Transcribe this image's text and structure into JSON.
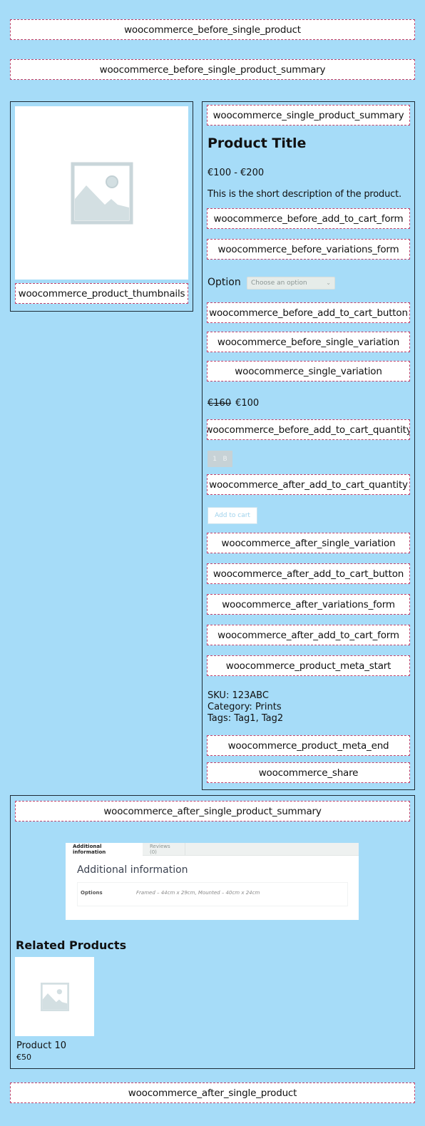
{
  "colors": {
    "background": "#a6dcf8",
    "hook_border": "#c0426a",
    "panel_border": "#1d2b36"
  },
  "hooks": {
    "before_single_product": "woocommerce_before_single_product",
    "before_single_product_summary": "woocommerce_before_single_product_summary",
    "product_thumbnails": "woocommerce_product_thumbnails",
    "single_product_summary": "woocommerce_single_product_summary",
    "before_add_to_cart_form": "woocommerce_before_add_to_cart_form",
    "before_variations_form": "woocommerce_before_variations_form",
    "before_add_to_cart_button": "woocommerce_before_add_to_cart_button",
    "before_single_variation": "woocommerce_before_single_variation",
    "single_variation": "woocommerce_single_variation",
    "before_add_to_cart_quantity": "woocommerce_before_add_to_cart_quantity",
    "after_add_to_cart_quantity": "woocommerce_after_add_to_cart_quantity",
    "after_single_variation": "woocommerce_after_single_variation",
    "after_add_to_cart_button": "woocommerce_after_add_to_cart_button",
    "after_variations_form": "woocommerce_after_variations_form",
    "after_add_to_cart_form": "woocommerce_after_add_to_cart_form",
    "product_meta_start": "woocommerce_product_meta_start",
    "product_meta_end": "woocommerce_product_meta_end",
    "share": "woocommerce_share",
    "after_single_product_summary": "woocommerce_after_single_product_summary",
    "after_single_product": "woocommerce_after_single_product"
  },
  "gallery": {
    "image_icon": "image-placeholder-icon"
  },
  "product": {
    "title": "Product Title",
    "price_range": "€100 - €200",
    "short_description": "This is the short description of the product.",
    "option_label": "Option",
    "option_select_value": "Choose an option",
    "variation_old_price": "€160",
    "variation_price": "€100",
    "quantity": "1",
    "quantity_stepper": "B",
    "add_to_cart_label": "Add to cart",
    "meta": {
      "sku": "SKU: 123ABC",
      "category": "Category: Prints",
      "tags": "Tags: Tag1, Tag2"
    }
  },
  "tabs": {
    "items": [
      {
        "label": "Additional information",
        "active": true
      },
      {
        "label": "Reviews (0)",
        "active": false
      }
    ],
    "heading": "Additional information",
    "attributes": [
      {
        "name": "Options",
        "value": "Framed – 44cm x 29cm, Mounted – 40cm x 24cm"
      }
    ]
  },
  "related": {
    "heading": "Related Products",
    "products": [
      {
        "name": "Product 10",
        "price": "€50"
      }
    ]
  }
}
